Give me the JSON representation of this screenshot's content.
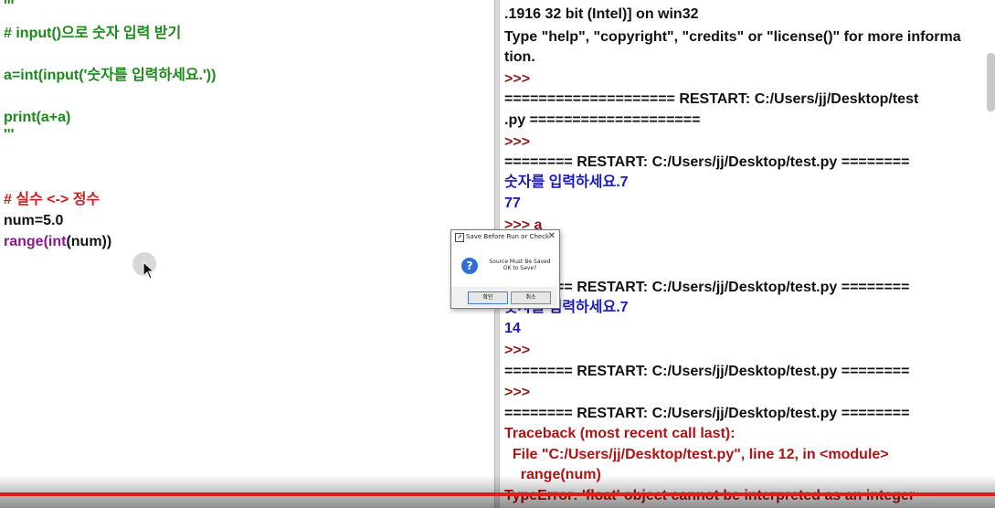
{
  "editor": {
    "lines": [
      {
        "text": "'''",
        "color": "#1a8a1a"
      },
      {
        "text": "# input()으로 숫자 입력 받기",
        "color": "#1a8a1a"
      },
      {
        "text": "a=int(input('숫자를 입력하세요.'))",
        "color": "#1a8a1a"
      },
      {
        "text": "print(a+a)",
        "color": "#1a8a1a"
      },
      {
        "text": "'''",
        "color": "#1a8a1a"
      },
      {
        "text": "# 실수 <-> 정수",
        "color": "#d11b1b"
      },
      {
        "text": "num=5.0",
        "color": "#111111"
      },
      {
        "prefix": "range(",
        "middle": "int",
        "suffix": "(num))"
      }
    ]
  },
  "shell": {
    "lines": [
      ".1916 32 bit (Intel)] on win32",
      "Type \"help\", \"copyright\", \"credits\" or \"license()\" for more informa",
      "tion.",
      ">>> ",
      "==================== RESTART: C:/Users/jj/Desktop/test",
      ".py ====================",
      ">>> ",
      "======== RESTART: C:/Users/jj/Desktop/test.py ========",
      "숫자를 입력하세요.7",
      "77",
      ">>> a",
      "======== RESTART: C:/Users/jj/Desktop/test.py ========",
      "숫자를 입력하세요.7",
      "14",
      ">>> ",
      "======== RESTART: C:/Users/jj/Desktop/test.py ========",
      ">>> ",
      "======== RESTART: C:/Users/jj/Desktop/test.py ========",
      "Traceback (most recent call last):",
      "  File \"C:/Users/jj/Desktop/test.py\", line 12, in <module>",
      "    range(num)",
      "TypeError: 'float' object cannot be interpreted as an integer"
    ]
  },
  "dialog": {
    "title": "Save Before Run or Check",
    "close": "✕",
    "message_line1": "Source Must Be Saved",
    "message_line2": "OK to Save?",
    "ok_label": "확인",
    "cancel_label": "취소",
    "icon": "question-icon"
  },
  "colors": {
    "comment": "#1a8a1a",
    "keyword": "#d11b1b",
    "builtin": "#8a1b8f",
    "prompt": "#8b1a1a",
    "stdout": "#1a1ab5",
    "error": "#b21212",
    "progress": "#e01c1c"
  }
}
